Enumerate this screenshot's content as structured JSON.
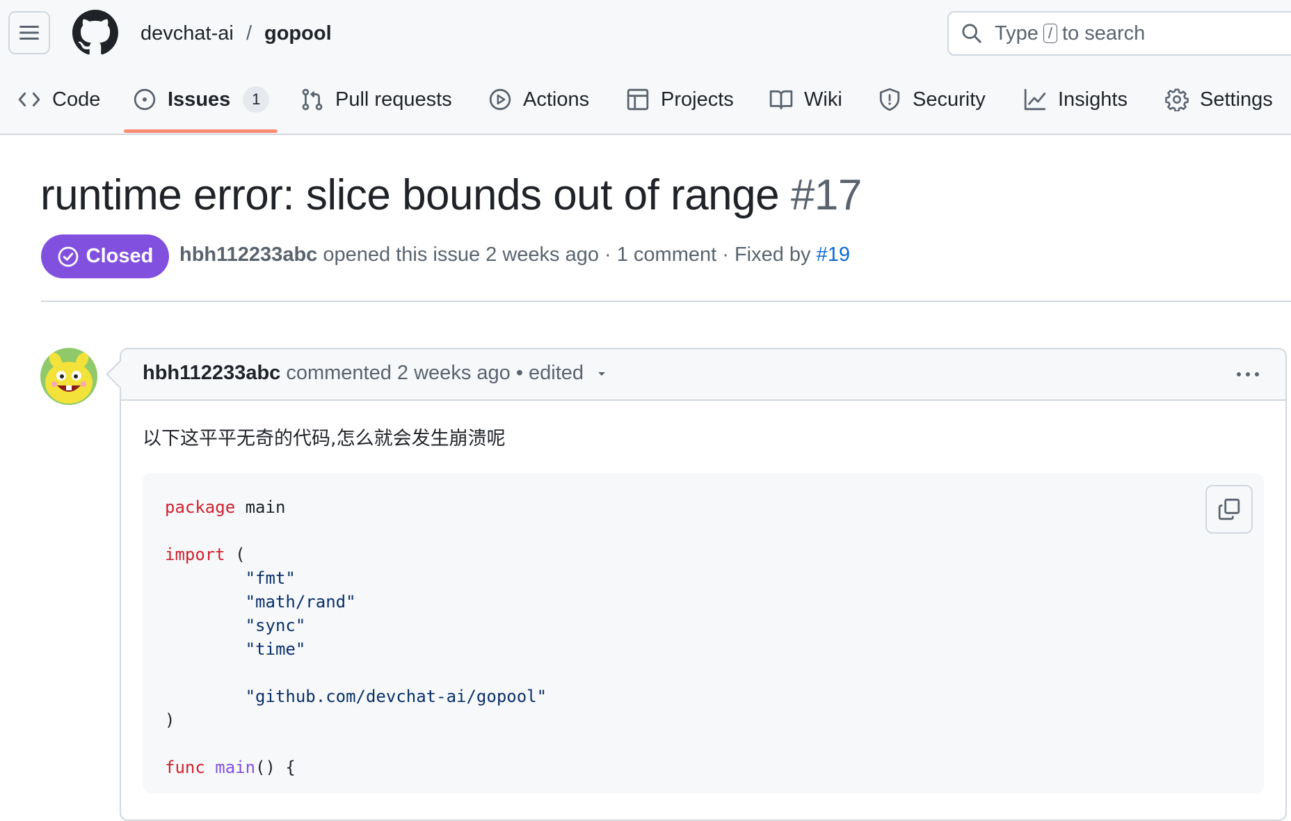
{
  "header": {
    "owner": "devchat-ai",
    "separator": "/",
    "repo": "gopool",
    "search_prefix": "Type",
    "search_key": "/",
    "search_suffix": "to search"
  },
  "tabs": [
    {
      "label": "Code",
      "icon": "code-icon"
    },
    {
      "label": "Issues",
      "icon": "issue-opened-icon",
      "counter": "1",
      "selected": true
    },
    {
      "label": "Pull requests",
      "icon": "git-pull-request-icon"
    },
    {
      "label": "Actions",
      "icon": "play-icon"
    },
    {
      "label": "Projects",
      "icon": "table-icon"
    },
    {
      "label": "Wiki",
      "icon": "book-icon"
    },
    {
      "label": "Security",
      "icon": "shield-icon"
    },
    {
      "label": "Insights",
      "icon": "graph-icon"
    },
    {
      "label": "Settings",
      "icon": "gear-icon"
    }
  ],
  "issue": {
    "title": "runtime error: slice bounds out of range",
    "number": "#17",
    "state": "Closed",
    "state_color": "#8250df",
    "author": "hbh112233abc",
    "opened_text": "opened this issue 2 weeks ago · 1 comment · Fixed by",
    "fixed_by": "#19"
  },
  "comment": {
    "author": "hbh112233abc",
    "action": "commented 2 weeks ago",
    "edited": "• edited",
    "body": "以下这平平无奇的代码,怎么就会发生崩溃呢",
    "code": {
      "l1_kw": "package",
      "l1_rest": " main",
      "l3_kw": "import",
      "l3_rest": " (",
      "l4": "        \"fmt\"",
      "l5": "        \"math/rand\"",
      "l6": "        \"sync\"",
      "l7": "        \"time\"",
      "l9": "        \"github.com/devchat-ai/gopool\"",
      "l10": ")",
      "l12_kw": "func",
      "l12_fn": " main",
      "l12_rest": "() {"
    }
  },
  "colors": {
    "accent": "#fd8c73",
    "link": "#0969da"
  }
}
